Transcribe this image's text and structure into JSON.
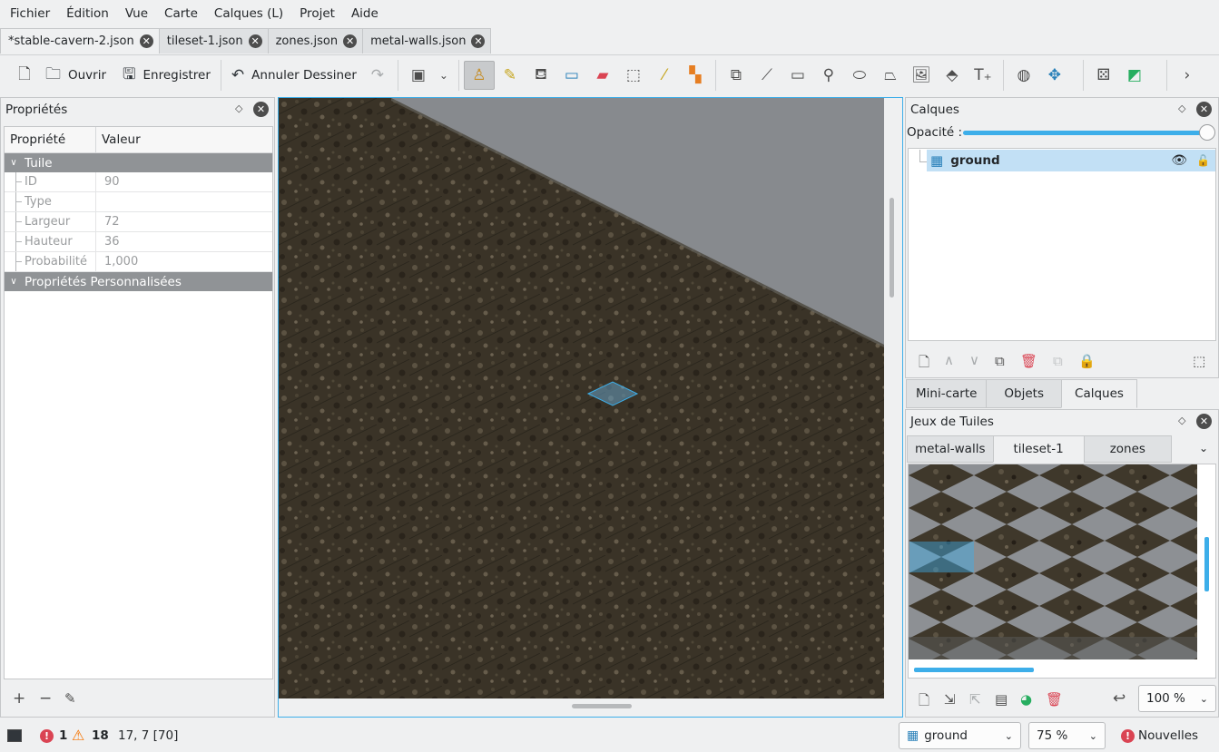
{
  "menu": [
    "Fichier",
    "Édition",
    "Vue",
    "Carte",
    "Calques (L)",
    "Projet",
    "Aide"
  ],
  "doc_tabs": [
    {
      "label": "*stable-cavern-2.json",
      "active": true
    },
    {
      "label": "tileset-1.json",
      "active": false
    },
    {
      "label": "zones.json",
      "active": false
    },
    {
      "label": "metal-walls.json",
      "active": false
    }
  ],
  "toolbar": {
    "open_label": "Ouvrir",
    "save_label": "Enregistrer",
    "undo_label": "Annuler Dessiner"
  },
  "properties": {
    "title": "Propriétés",
    "col_property": "Propriété",
    "col_value": "Valeur",
    "group_tile": "Tuile",
    "rows": [
      {
        "key": "ID",
        "value": "90"
      },
      {
        "key": "Type",
        "value": ""
      },
      {
        "key": "Largeur",
        "value": "72"
      },
      {
        "key": "Hauteur",
        "value": "36"
      },
      {
        "key": "Probabilité",
        "value": "1,000"
      }
    ],
    "group_custom": "Propriétés Personnalisées"
  },
  "layers": {
    "title": "Calques",
    "opacity_label": "Opacité :",
    "opacity_value": 1.0,
    "items": [
      {
        "name": "ground",
        "visible": true,
        "locked": false
      }
    ]
  },
  "right_tabs": [
    {
      "label": "Mini-carte",
      "active": false
    },
    {
      "label": "Objets",
      "active": false
    },
    {
      "label": "Calques",
      "active": true
    }
  ],
  "tilesets": {
    "title": "Jeux de Tuiles",
    "tabs": [
      {
        "label": "metal-walls",
        "active": false
      },
      {
        "label": "tileset-1",
        "active": true
      },
      {
        "label": "zones",
        "active": false
      }
    ],
    "zoom": "100 %"
  },
  "status": {
    "errors": "1",
    "warnings": "18",
    "coords": "17, 7 [70]",
    "layer": "ground",
    "zoom": "75 %",
    "news": "Nouvelles"
  },
  "colors": {
    "accent": "#3daee9",
    "selected_bg": "#c2e0f5",
    "group_header": "#909396",
    "error": "#da4453",
    "warning": "#f67400",
    "ground_tile": "#3a3327",
    "void": "#878a8e"
  }
}
